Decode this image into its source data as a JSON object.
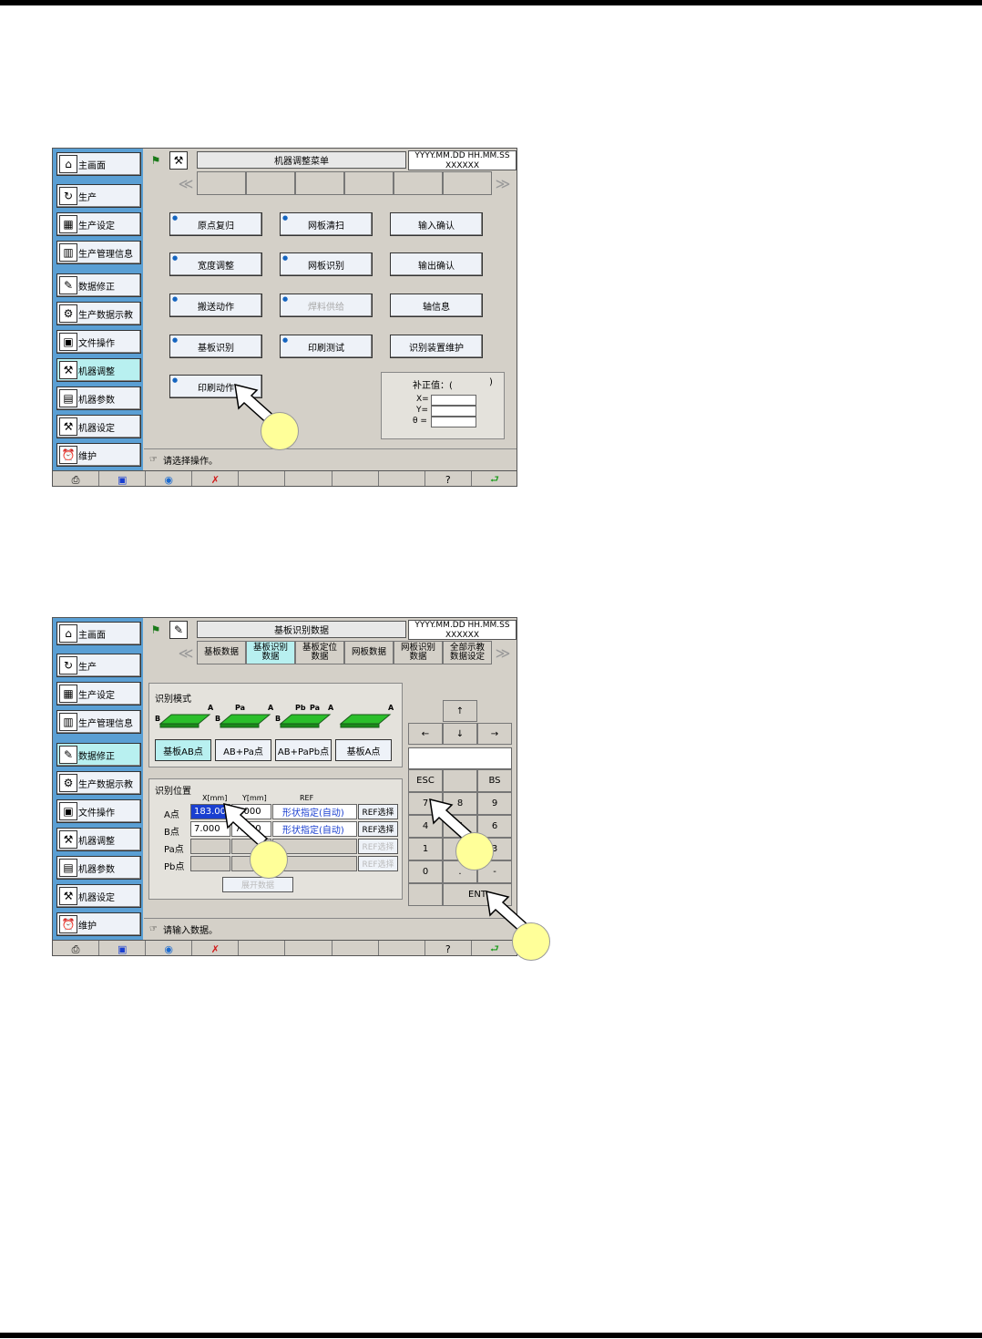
{
  "screen1": {
    "sidebar": [
      {
        "label": "主画面",
        "icon": "home-icon",
        "glyph": "⌂",
        "active": false
      },
      {
        "label": "生产",
        "icon": "cycle-icon",
        "glyph": "↻",
        "active": false
      },
      {
        "label": "生产设定",
        "icon": "production-settings-icon",
        "glyph": "▦",
        "active": false
      },
      {
        "label": "生产管理信息",
        "icon": "chart-icon",
        "glyph": "▥",
        "active": false
      },
      {
        "label": "数据修正",
        "icon": "edit-data-icon",
        "glyph": "✎",
        "active": false
      },
      {
        "label": "生产数据示教",
        "icon": "teach-icon",
        "glyph": "⚙",
        "active": false
      },
      {
        "label": "文件操作",
        "icon": "floppy-icon",
        "glyph": "▣",
        "active": false
      },
      {
        "label": "机器调整",
        "icon": "machine-adjust-icon",
        "glyph": "⚒",
        "active": true
      },
      {
        "label": "机器参数",
        "icon": "machine-params-icon",
        "glyph": "▤",
        "active": false
      },
      {
        "label": "机器设定",
        "icon": "machine-settings-icon",
        "glyph": "⚒",
        "active": false
      },
      {
        "label": "维护",
        "icon": "alarm-clock-icon",
        "glyph": "⏰",
        "active": false
      }
    ],
    "title": "机器调整菜单",
    "date": "YYYY.MM.DD HH.MM.SS",
    "machine": "XXXXXX",
    "buttons": [
      {
        "label": "原点复归",
        "disabled": false
      },
      {
        "label": "网板清扫",
        "disabled": false
      },
      {
        "label": "输入确认",
        "disabled": false
      },
      {
        "label": "宽度调整",
        "disabled": false
      },
      {
        "label": "网板识别",
        "disabled": false
      },
      {
        "label": "输出确认",
        "disabled": false
      },
      {
        "label": "搬送动作",
        "disabled": false
      },
      {
        "label": "焊料供给",
        "disabled": true
      },
      {
        "label": "轴信息",
        "disabled": false
      },
      {
        "label": "基板识别",
        "disabled": false
      },
      {
        "label": "印刷测试",
        "disabled": false
      },
      {
        "label": "识别装置维护",
        "disabled": false
      },
      {
        "label": "印刷动作",
        "disabled": false
      }
    ],
    "correction": {
      "title": "补正值：(",
      "close": ")",
      "x": "X=",
      "y": "Y=",
      "theta": "θ ="
    },
    "status": "请选择操作。"
  },
  "screen2": {
    "title": "基板识别数据",
    "date": "YYYY.MM.DD HH.MM.SS",
    "machine": "XXXXXX",
    "tabs": [
      {
        "label": "基板数据",
        "active": false
      },
      {
        "label": "基板识别\n数据",
        "active": true
      },
      {
        "label": "基板定位\n数据",
        "active": false
      },
      {
        "label": "网板数据",
        "active": false
      },
      {
        "label": "网板识别\n数据",
        "active": false
      },
      {
        "label": "全部示教\n数据设定",
        "active": false
      }
    ],
    "mode_group": "识别模式",
    "pattern_labels": [
      [
        "B",
        "A"
      ],
      [
        "B",
        "Pa",
        "A"
      ],
      [
        "B",
        "Pb",
        "Pa",
        "A"
      ],
      [
        "A"
      ]
    ],
    "pattern_buttons": [
      {
        "label": "基板AB点",
        "active": true
      },
      {
        "label": "AB+Pa点",
        "active": false
      },
      {
        "label": "AB+PaPb点",
        "active": false
      },
      {
        "label": "基板A点",
        "active": false
      }
    ],
    "position_group": "识别位置",
    "headers": {
      "x": "X[mm]",
      "y": "Y[mm]",
      "ref": "REF"
    },
    "rows": [
      {
        "label": "A点",
        "x": "183.000",
        "y": "7.000",
        "ref": "形状指定(自动)",
        "btn": "REF选择",
        "enabled": true
      },
      {
        "label": "B点",
        "x": "7.000",
        "y": "7.000",
        "ref": "形状指定(自动)",
        "btn": "REF选择",
        "enabled": true
      },
      {
        "label": "Pa点",
        "x": "",
        "y": "",
        "ref": "",
        "btn": "REF选择",
        "enabled": false
      },
      {
        "label": "Pb点",
        "x": "",
        "y": "",
        "ref": "",
        "btn": "REF选择",
        "enabled": false
      }
    ],
    "expand_button": "展开数据",
    "keypad": {
      "up": "↑",
      "left": "←",
      "down": "↓",
      "right": "→",
      "esc": "ESC",
      "bs": "BS",
      "keys": [
        "7",
        "8",
        "9",
        "4",
        "5",
        "6",
        "1",
        "2",
        "3",
        "0",
        ".",
        "-"
      ],
      "ent": "ENT"
    },
    "status": "请输入数据。"
  },
  "bottom_icons": [
    "printer-icon",
    "screen-icon",
    "globe-icon",
    "cancel-icon",
    "",
    "",
    "",
    "",
    "help-icon",
    "return-icon"
  ],
  "bottom_glyphs": [
    "⎙",
    "▣",
    "◉",
    "✗",
    "",
    "",
    "",
    "",
    "?",
    "⮐"
  ]
}
